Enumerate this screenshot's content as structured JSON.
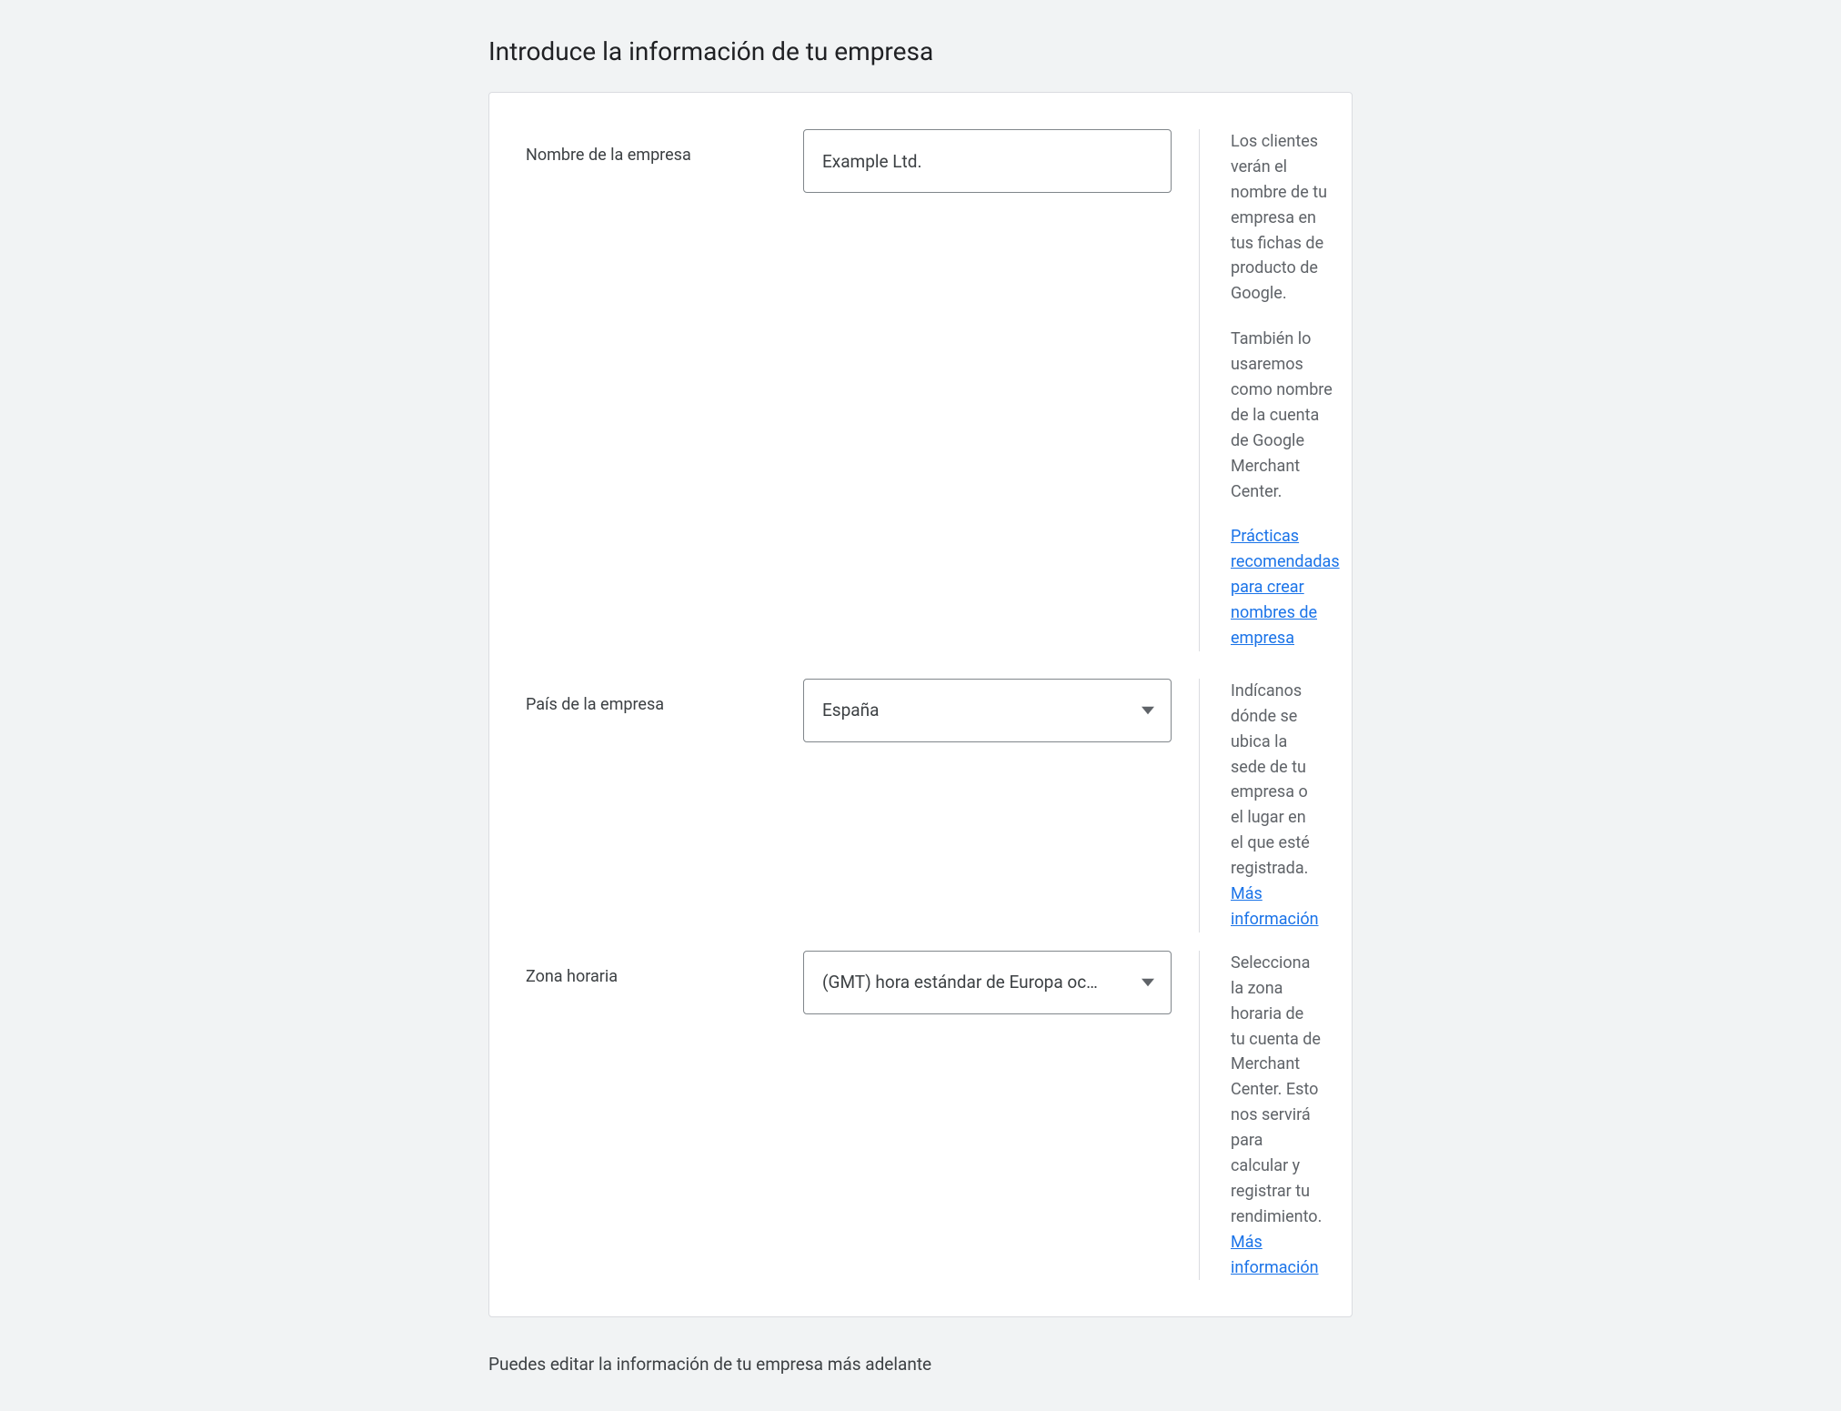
{
  "page": {
    "title": "Introduce la información de tu empresa"
  },
  "form": {
    "businessName": {
      "label": "Nombre de la empresa",
      "value": "Example Ltd.",
      "help1": "Los clientes verán el nombre de tu empresa en tus fichas de producto de Google.",
      "help2": "También lo usaremos como nombre de la cuenta de Google Merchant Center.",
      "link": "Prácticas recomendadas para crear nombres de empresa"
    },
    "country": {
      "label": "País de la empresa",
      "value": "España",
      "help": "Indícanos dónde se ubica la sede de tu empresa o el lugar en el que esté registrada. ",
      "link": "Más información"
    },
    "timezone": {
      "label": "Zona horaria",
      "value": "(GMT) hora estándar de Europa oc…",
      "help": "Selecciona la zona horaria de tu cuenta de Merchant Center. Esto nos servirá para calcular y registrar tu rendimiento. ",
      "link": "Más información"
    }
  },
  "footer": {
    "note": "Puedes editar la información de tu empresa más adelante"
  }
}
